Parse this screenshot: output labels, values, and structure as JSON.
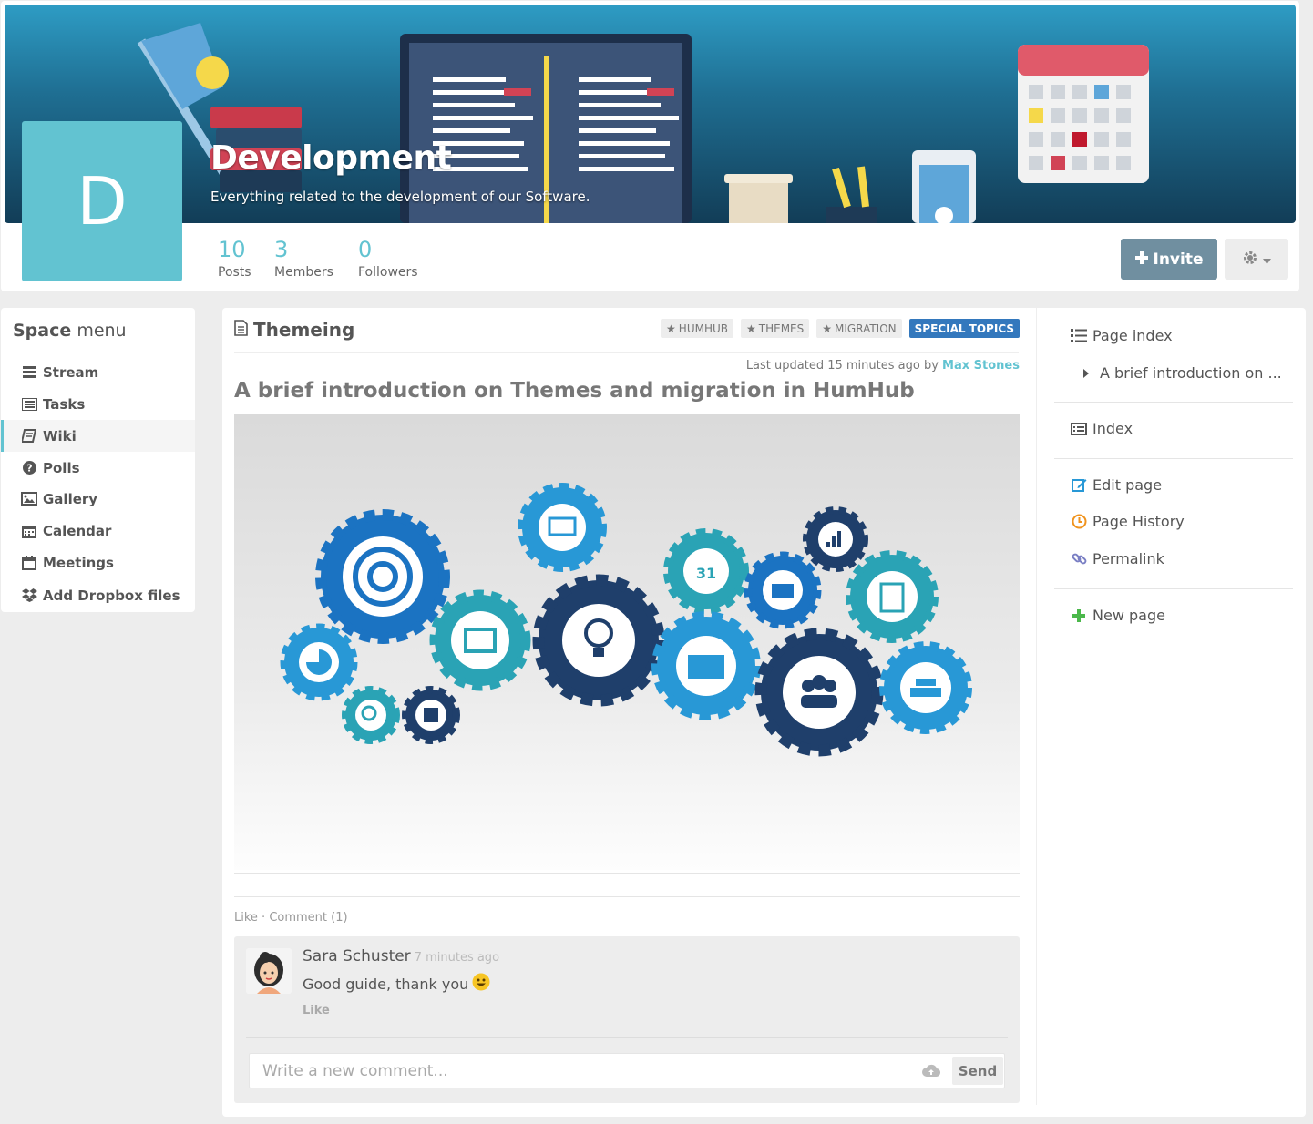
{
  "space": {
    "initial": "D",
    "name": "Development",
    "description": "Everything related to the development of our Software.",
    "stats": [
      {
        "value": "10",
        "label": "Posts"
      },
      {
        "value": "3",
        "label": "Members"
      },
      {
        "value": "0",
        "label": "Followers"
      }
    ],
    "invite_label": "Invite",
    "accent_color": "#62c3d1"
  },
  "space_menu": {
    "heading_bold": "Space",
    "heading_light": "menu",
    "items": [
      {
        "label": "Stream",
        "icon": "bars-icon"
      },
      {
        "label": "Tasks",
        "icon": "tasks-icon"
      },
      {
        "label": "Wiki",
        "icon": "book-icon",
        "active": true
      },
      {
        "label": "Polls",
        "icon": "question-circle-icon"
      },
      {
        "label": "Gallery",
        "icon": "image-icon"
      },
      {
        "label": "Calendar",
        "icon": "calendar-icon"
      },
      {
        "label": "Meetings",
        "icon": "calendar-empty-icon"
      },
      {
        "label": "Add Dropbox files",
        "icon": "dropbox-icon"
      }
    ]
  },
  "wiki": {
    "page_title": "Themeing",
    "tags": [
      {
        "label": "HUMHUB",
        "icon": "star-icon"
      },
      {
        "label": "THEMES",
        "icon": "star-icon"
      },
      {
        "label": "MIGRATION",
        "icon": "star-icon"
      },
      {
        "label": "SPECIAL TOPICS",
        "primary": true
      }
    ],
    "last_updated_prefix": "Last updated 15 minutes ago by",
    "last_updated_author": "Max Stones",
    "heading": "A brief introduction on Themes and migration in HumHub",
    "like_comment": "Like · Comment (1)",
    "comment": {
      "author": "Sara Schuster",
      "time": "7 minutes ago",
      "text": "Good guide, thank you",
      "like_label": "Like"
    },
    "comment_input": {
      "placeholder": "Write a new comment...",
      "send_label": "Send"
    }
  },
  "wiki_nav": {
    "page_index_label": "Page index",
    "index_entry": "A brief introduction on ...",
    "index_label": "Index",
    "edit_label": "Edit page",
    "history_label": "Page History",
    "permalink_label": "Permalink",
    "new_page_label": "New page"
  }
}
